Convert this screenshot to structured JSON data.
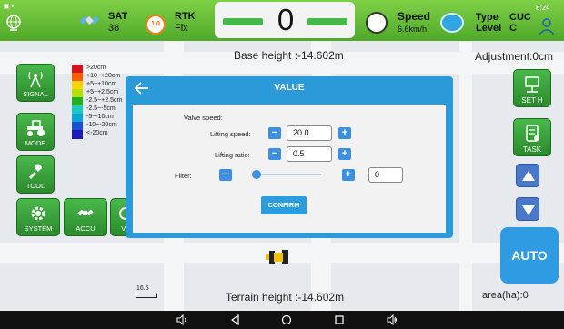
{
  "status": {
    "sat_label": "SAT",
    "sat_value": "38",
    "rtk_badge": "1.0",
    "rtk_label": "RTK",
    "rtk_value": "Fix",
    "counter": "0",
    "speed_label": "Speed",
    "speed_value": "6.6km/h",
    "type_label": "Type",
    "type_value": "CUC",
    "level_label": "Level",
    "level_value": "C",
    "time": "8:24"
  },
  "base_height": "Base height :-14.602m",
  "adjustment": "Adjustment:0cm",
  "terrain_height": "Terrain height :-14.602m",
  "area": "area(ha):0",
  "scale": "16.5",
  "left_buttons": {
    "signal": "SIGNAL",
    "mode": "MODE",
    "tool": "TOOL",
    "system": "SYSTEM",
    "accu": "ACCU",
    "va": "VA"
  },
  "right_buttons": {
    "seth": "SET H",
    "task": "TASK",
    "auto": "AUTO"
  },
  "legend": [
    {
      "label": ">20cm",
      "color": "#d8111a"
    },
    {
      "label": "+10~+20cm",
      "color": "#ff5b00"
    },
    {
      "label": "+5~+10cm",
      "color": "#ffd500"
    },
    {
      "label": "+5~+2.5cm",
      "color": "#b7e000"
    },
    {
      "label": "-2.5~+2.5cm",
      "color": "#1fb21c"
    },
    {
      "label": "-2.5~-5cm",
      "color": "#19c9c2"
    },
    {
      "label": "-5~-10cm",
      "color": "#0ba6d8"
    },
    {
      "label": "-10~-20cm",
      "color": "#1a4fd6"
    },
    {
      "label": "<-20cm",
      "color": "#1a1bb8"
    }
  ],
  "dialog": {
    "title": "VALUE",
    "valve_speed_label": "Valve speed:",
    "lifting_speed_label": "Lifting speed:",
    "lifting_speed_value": "20.0",
    "lifting_ratio_label": "Lifting ratio:",
    "lifting_ratio_value": "0.5",
    "filter_label": "Filter:",
    "filter_value": "0",
    "confirm_label": "CONFIRM",
    "minus": "−",
    "plus": "+"
  },
  "colors": {
    "status_green": "#4fa92a",
    "button_green": "#2c8a2d",
    "dialog_blue": "#2b9ad9",
    "auto_blue": "#2f9be3"
  }
}
